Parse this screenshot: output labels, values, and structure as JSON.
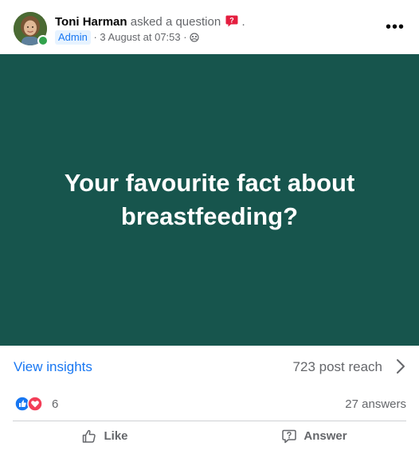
{
  "header": {
    "author": "Toni Harman",
    "action": "asked a question",
    "trailing": ".",
    "role_badge": "Admin",
    "timestamp": "· 3 August at 07:53 ·",
    "more": "•••"
  },
  "question": {
    "text": "Your favourite fact about breastfeeding?",
    "background_color": "#17554d"
  },
  "insights": {
    "view_label": "View insights",
    "reach": "723 post reach"
  },
  "reactions": {
    "count": "6",
    "answers": "27 answers"
  },
  "actions": {
    "like_label": "Like",
    "answer_label": "Answer"
  },
  "colors": {
    "accent": "#1877f2",
    "secondary_text": "#65676b",
    "online": "#31a24c"
  }
}
